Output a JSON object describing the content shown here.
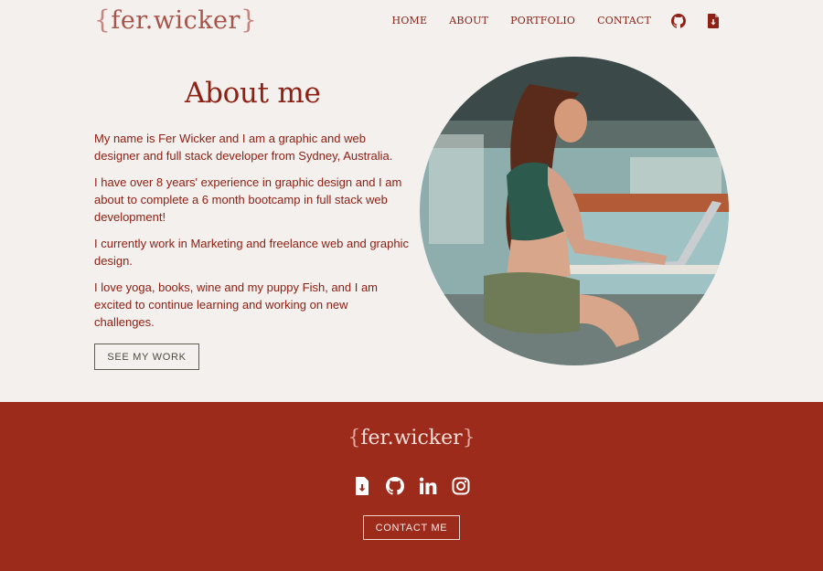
{
  "header": {
    "logo": "fer.wicker",
    "nav": {
      "home": "HOME",
      "about": "ABOUT",
      "portfolio": "PORTFOLIO",
      "contact": "CONTACT"
    },
    "icons": [
      "github-icon",
      "download-resume-icon"
    ]
  },
  "about": {
    "title": "About me",
    "paragraphs": [
      "My name is Fer Wicker and I am a graphic and web designer and full stack developer from Sydney, Australia.",
      "I have over 8 years' experience in graphic design and I am about to complete a 6 month bootcamp in full stack web development!",
      "I currently work in Marketing and freelance web and graphic design.",
      "I love yoga, books, wine and my puppy Fish, and I am excited to continue learning and working on new challenges."
    ],
    "button": "SEE MY WORK"
  },
  "footer": {
    "logo": "fer.wicker",
    "social_icons": [
      "download-resume-icon",
      "github-icon",
      "linkedin-icon",
      "instagram-icon"
    ],
    "button": "CONTACT ME"
  },
  "colors": {
    "background": "#f3f0ee",
    "accent": "#8f2014",
    "footer": "#9c2b1c"
  }
}
